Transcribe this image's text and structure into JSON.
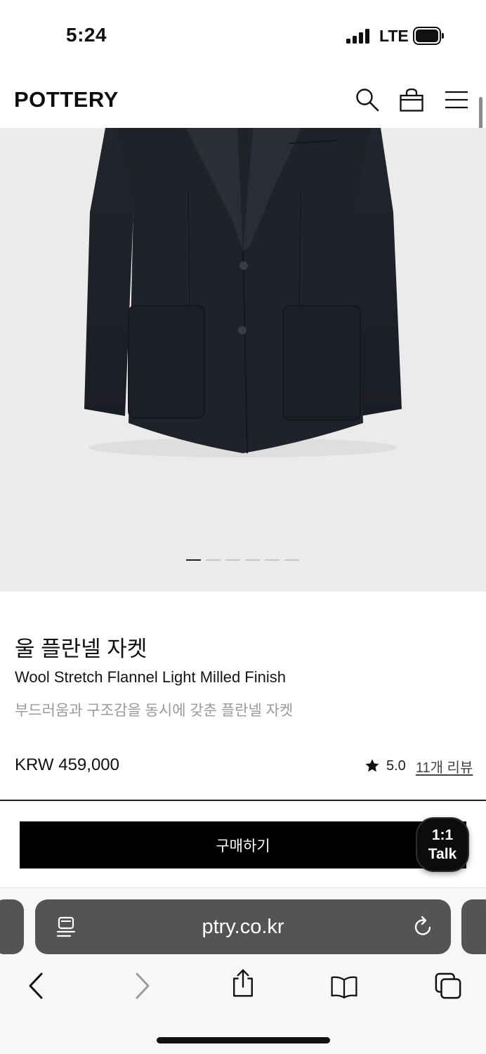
{
  "status_bar": {
    "time": "5:24",
    "network": "LTE"
  },
  "header": {
    "logo": "POTTERY"
  },
  "product": {
    "name_ko": "울 플란넬 자켓",
    "name_en": "Wool Stretch Flannel Light Milled Finish",
    "description": "부드러움과 구조감을 동시에 갖춘 플란넬 자켓",
    "price": "KRW 459,000",
    "rating": "5.0",
    "reviews": "11개 리뷰",
    "image_count": 6,
    "active_image": 1
  },
  "actions": {
    "buy_label": "구매하기",
    "talk_line1": "1:1",
    "talk_line2": "Talk"
  },
  "browser": {
    "url": "ptry.co.kr"
  },
  "colors": {
    "accent": "#000000",
    "muted_text": "#9a9a9a",
    "image_bg": "#ebebeb"
  }
}
